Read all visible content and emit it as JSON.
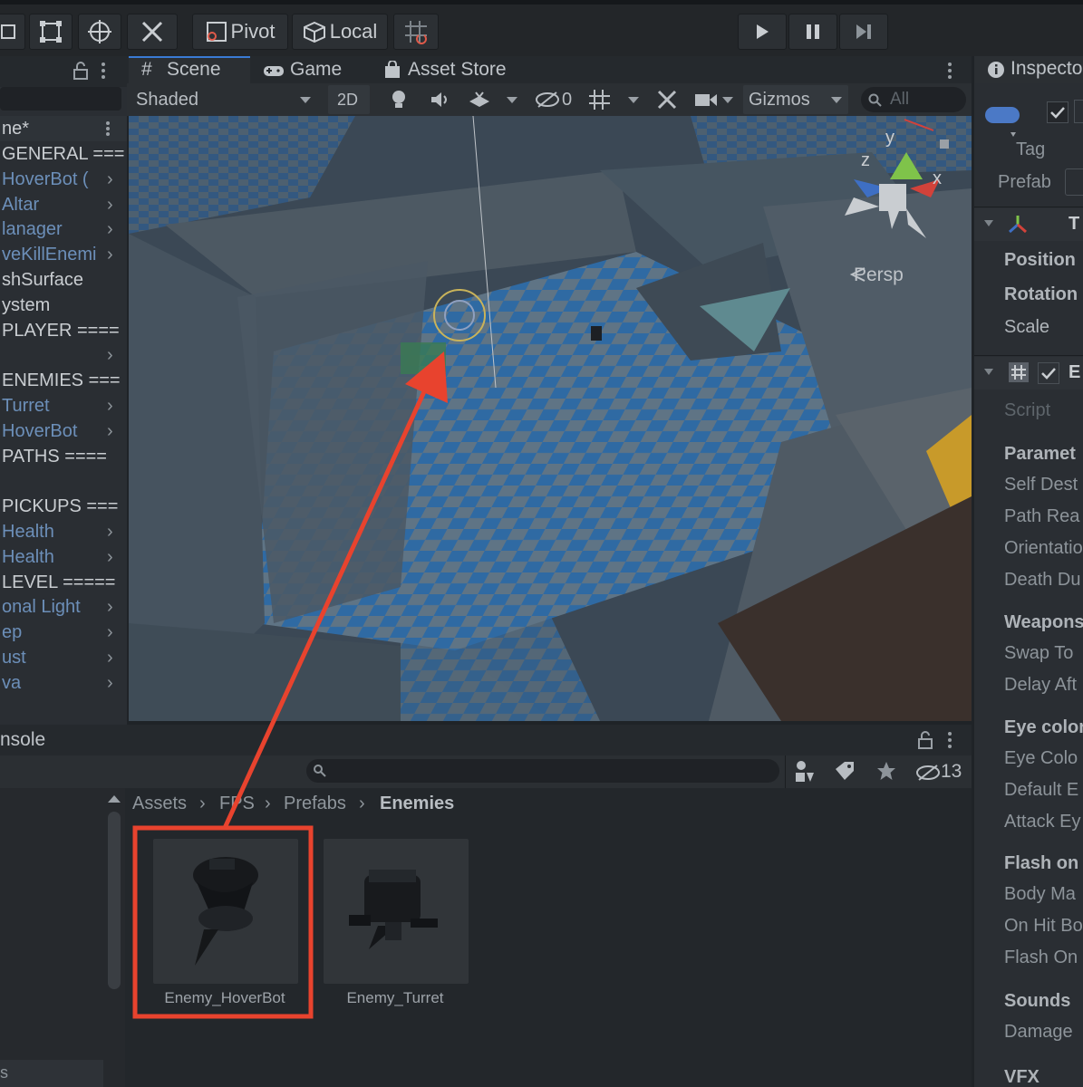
{
  "toolbar": {
    "pivot_label": "Pivot",
    "local_label": "Local"
  },
  "hierarchy": {
    "scene_name": "ne*",
    "items": [
      {
        "label": "GENERAL ===",
        "color": "white",
        "chevron": false
      },
      {
        "label": "HoverBot (",
        "color": "blue",
        "chevron": true
      },
      {
        "label": "Altar",
        "color": "blue",
        "chevron": true
      },
      {
        "label": "lanager",
        "color": "blue",
        "chevron": true
      },
      {
        "label": "veKillEnemi",
        "color": "blue",
        "chevron": true
      },
      {
        "label": "shSurface",
        "color": "white",
        "chevron": false
      },
      {
        "label": "ystem",
        "color": "white",
        "chevron": false
      },
      {
        "label": "PLAYER ====",
        "color": "white",
        "chevron": false
      },
      {
        "label": "",
        "color": "blue",
        "chevron": true
      },
      {
        "label": "ENEMIES ===",
        "color": "white",
        "chevron": false
      },
      {
        "label": "Turret",
        "color": "blue",
        "chevron": true
      },
      {
        "label": "HoverBot",
        "color": "blue",
        "chevron": true
      },
      {
        "label": "PATHS ====",
        "color": "white",
        "chevron": false
      },
      {
        "label": "",
        "color": "white",
        "chevron": false
      },
      {
        "label": "PICKUPS ===",
        "color": "white",
        "chevron": false
      },
      {
        "label": "Health",
        "color": "blue",
        "chevron": true
      },
      {
        "label": "Health",
        "color": "blue",
        "chevron": true
      },
      {
        "label": "LEVEL =====",
        "color": "white",
        "chevron": false
      },
      {
        "label": "onal Light",
        "color": "blue",
        "chevron": true
      },
      {
        "label": "ep",
        "color": "blue",
        "chevron": true
      },
      {
        "label": "ust",
        "color": "blue",
        "chevron": true
      },
      {
        "label": "va",
        "color": "blue",
        "chevron": true
      }
    ]
  },
  "scene": {
    "tabs": {
      "scene": "Scene",
      "game": "Game",
      "asset_store": "Asset Store"
    },
    "shading_mode": "Shaded",
    "mode_2d": "2D",
    "hidden_count": "0",
    "gizmos_label": "Gizmos",
    "search_placeholder": "All",
    "view_label": "Persp",
    "axis_labels": {
      "y": "y",
      "z": "z",
      "x": "x"
    }
  },
  "inspector": {
    "title": "Inspecto",
    "tag_label": "Tag",
    "prefab_label": "Prefab",
    "transform_label": "T",
    "position_label": "Position",
    "rotation_label": "Rotation",
    "scale_label": "Scale",
    "component_label": "E",
    "rows": [
      {
        "label": "Script",
        "kind": "field"
      },
      {
        "label": "Paramet",
        "kind": "header"
      },
      {
        "label": "Self Dest",
        "kind": "field"
      },
      {
        "label": "Path Rea",
        "kind": "field"
      },
      {
        "label": "Orientatio",
        "kind": "field"
      },
      {
        "label": "Death Du",
        "kind": "field"
      },
      {
        "label": "Weapons",
        "kind": "header"
      },
      {
        "label": "Swap To",
        "kind": "field"
      },
      {
        "label": "Delay Aft",
        "kind": "field"
      },
      {
        "label": "Eye color",
        "kind": "header"
      },
      {
        "label": "Eye Colo",
        "kind": "field"
      },
      {
        "label": "Default E",
        "kind": "field"
      },
      {
        "label": "Attack Ey",
        "kind": "field"
      },
      {
        "label": "Flash on",
        "kind": "header"
      },
      {
        "label": "Body Ma",
        "kind": "field"
      },
      {
        "label": "On Hit Bo",
        "kind": "field"
      },
      {
        "label": "Flash On",
        "kind": "field"
      },
      {
        "label": "Sounds",
        "kind": "header"
      },
      {
        "label": "Damage",
        "kind": "field"
      },
      {
        "label": "VFX",
        "kind": "header"
      }
    ]
  },
  "console": {
    "title": "nsole",
    "hidden_count": "13",
    "left_bottom": "s"
  },
  "project": {
    "breadcrumb": [
      "Assets",
      "FPS",
      "Prefabs",
      "Enemies"
    ],
    "assets": [
      {
        "label": "Enemy_HoverBot",
        "highlighted": true
      },
      {
        "label": "Enemy_Turret",
        "highlighted": false
      }
    ]
  },
  "annotation_color": "#e8432e"
}
